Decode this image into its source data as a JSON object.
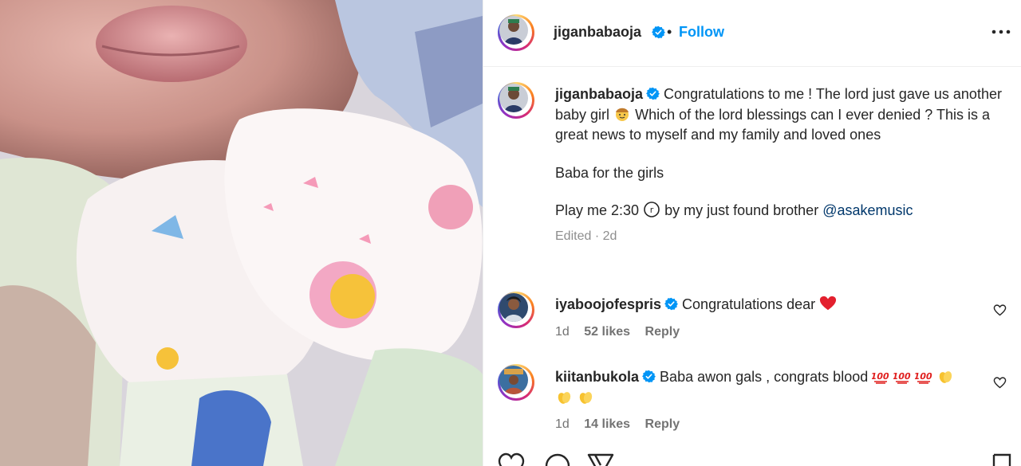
{
  "post": {
    "username": "jiganbabaoja",
    "follow_label": "Follow",
    "separator": "•",
    "caption_lines": [
      "Congratulations to me ! The lord just gave us another baby girl",
      "Which of the lord blessings can I ever denied ? This is a great news to myself and my family and loved ones"
    ],
    "caption_p2": "Baba for the girls",
    "caption_p3_a": "Play me 2:30",
    "caption_p3_b": "by my just found brother",
    "caption_mention": "@asakemusic",
    "edited": "Edited",
    "edited_sep": "·",
    "edited_age": "2d"
  },
  "comments": [
    {
      "username": "iyaboojofespris",
      "text": "Congratulations dear",
      "age": "1d",
      "likes": "52 likes",
      "reply": "Reply"
    },
    {
      "username": "kiitanbukola",
      "text": "Baba awon gals , congrats blood",
      "age": "1d",
      "likes": "14 likes",
      "reply": "Reply"
    }
  ],
  "colors": {
    "accent": "#0095f6",
    "verified": "#0095f6",
    "mention": "#00376b",
    "heart": "#ed4956"
  }
}
